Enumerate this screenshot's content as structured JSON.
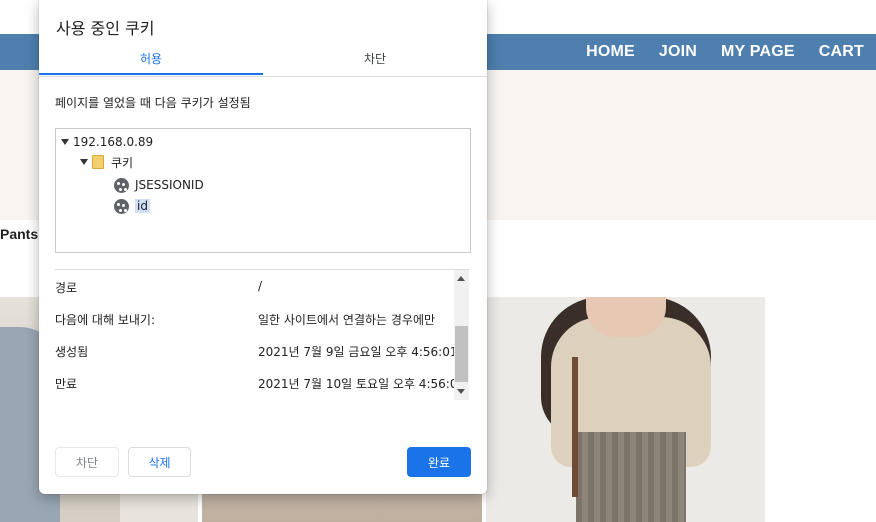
{
  "background": {
    "nav": [
      "HOME",
      "JOIN",
      "MY PAGE",
      "CART"
    ],
    "section_label": "Pants"
  },
  "dialog": {
    "title": "사용 중인 쿠키",
    "tabs": {
      "allow": "허용",
      "block": "차단"
    },
    "description": "페이지를 열었을 때 다음 쿠키가 설정됨",
    "tree": {
      "host": "192.168.0.89",
      "folder": "쿠키",
      "cookies": [
        "JSESSIONID",
        "id"
      ],
      "selected": "id"
    },
    "details": [
      {
        "label": "경로",
        "value": "/"
      },
      {
        "label": "다음에 대해 보내기:",
        "value": "일한 사이트에서 연결하는 경우에만"
      },
      {
        "label": "생성됨",
        "value": "2021년 7월 9일 금요일 오후 4:56:01"
      },
      {
        "label": "만료",
        "value": "2021년 7월 10일 토요일 오후 4:56:0"
      }
    ],
    "buttons": {
      "block": "차단",
      "delete": "삭제",
      "done": "완료"
    },
    "accent_color": "#1a73e8"
  },
  "colors": {
    "nav_bar": "#4e7fae",
    "hero_bg": "#f8f5f1"
  },
  "icons": [
    "tree-expand-icon",
    "folder-icon",
    "cookie-icon",
    "scroll-up-icon",
    "scroll-down-icon"
  ]
}
